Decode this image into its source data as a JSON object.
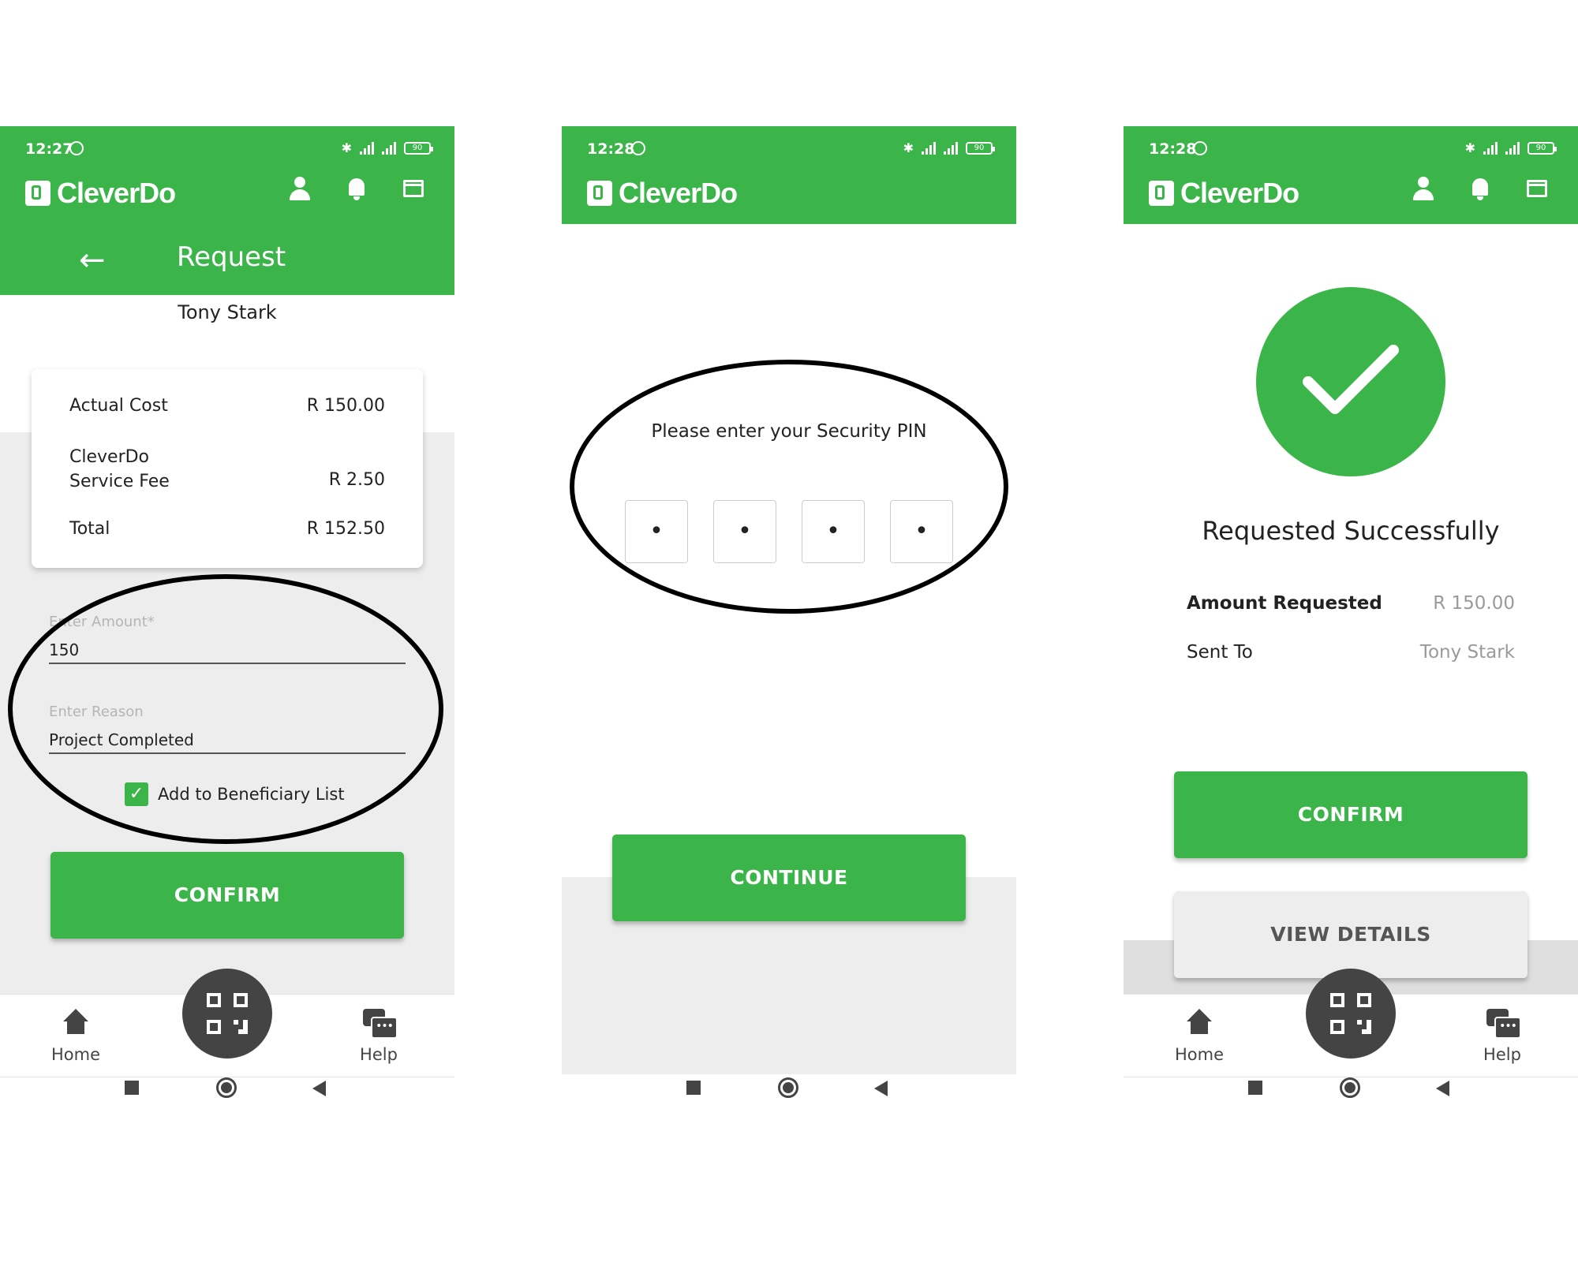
{
  "brand": "CleverDo",
  "colors": {
    "primary": "#3bb54a",
    "dark": "#444444",
    "background_gray": "#ededed"
  },
  "screen1": {
    "time": "12:27",
    "battery": "90",
    "title": "Request",
    "recipient": "Tony Stark",
    "summary": [
      {
        "label": "Actual Cost",
        "value": "R 150.00"
      },
      {
        "label": "CleverDo\nService Fee",
        "value": "R 2.50"
      },
      {
        "label": "Total",
        "value": "R 152.50"
      }
    ],
    "amount_label": "Enter Amount*",
    "amount_value": "150",
    "reason_label": "Enter Reason",
    "reason_value": "Project Completed",
    "beneficiary_label": "Add to Beneficiary List",
    "beneficiary_checked": true,
    "confirm_label": "CONFIRM"
  },
  "screen2": {
    "time": "12:28",
    "battery": "90",
    "pin_prompt": "Please enter your Security PIN",
    "pin_digits": [
      "•",
      "•",
      "•",
      "•"
    ],
    "continue_label": "CONTINUE"
  },
  "screen3": {
    "time": "12:28",
    "battery": "90",
    "success_title": "Requested Successfully",
    "details": [
      {
        "label": "Amount Requested",
        "value": "R 150.00"
      },
      {
        "label": "Sent To",
        "value": "Tony Stark"
      }
    ],
    "confirm_label": "CONFIRM",
    "view_details_label": "VIEW DETAILS"
  },
  "bottom_nav": {
    "home": "Home",
    "help": "Help"
  },
  "icons": [
    "alarm-icon",
    "bluetooth-icon",
    "signal-icon",
    "battery-icon",
    "person-icon",
    "bell-icon",
    "card-icon",
    "back-arrow-icon",
    "home-icon",
    "qr-code-icon",
    "help-chat-icon",
    "check-icon"
  ]
}
